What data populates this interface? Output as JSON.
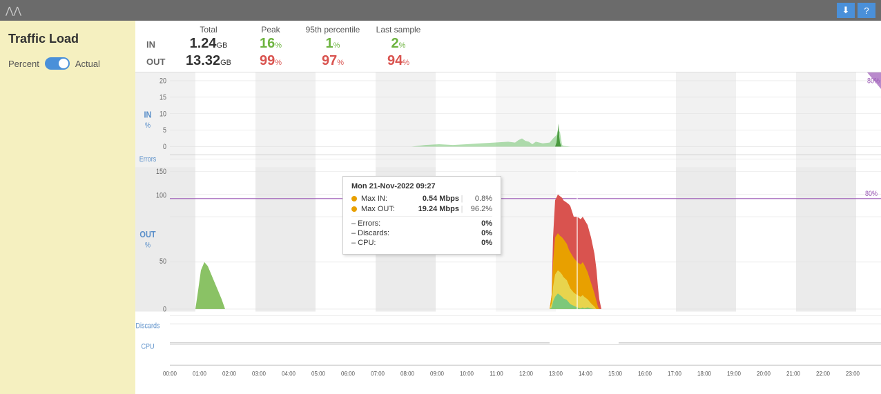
{
  "topbar": {
    "chevron_icon": "chevrons-up",
    "download_icon": "download",
    "help_icon": "question"
  },
  "sidebar": {
    "title": "Traffic Load",
    "percent_label": "Percent",
    "actual_label": "Actual"
  },
  "stats": {
    "headers": [
      "Total",
      "Peak",
      "95th percentile",
      "Last sample"
    ],
    "in_label": "IN",
    "out_label": "OUT",
    "in_total": "1.24",
    "in_total_unit": "GB",
    "in_peak": "16",
    "in_peak_unit": "%",
    "in_95th": "1",
    "in_95th_unit": "%",
    "in_last": "2",
    "in_last_unit": "%",
    "out_total": "13.32",
    "out_total_unit": "GB",
    "out_peak": "99",
    "out_peak_unit": "%",
    "out_95th": "97",
    "out_95th_unit": "%",
    "out_last": "94",
    "out_last_unit": "%"
  },
  "chart": {
    "in_label": "IN\n%",
    "out_label": "OUT\n%",
    "in_y_values": [
      "20",
      "15",
      "10",
      "5",
      "0"
    ],
    "out_y_values": [
      "150",
      "100",
      "50",
      "0"
    ],
    "threshold_label": "80%",
    "threshold_label2": "80%",
    "x_labels": [
      "00:00",
      "01:00",
      "02:00",
      "03:00",
      "04:00",
      "05:00",
      "06:00",
      "07:00",
      "08:00",
      "09:00",
      "10:00",
      "11:00",
      "12:00",
      "13:00",
      "14:00",
      "15:00",
      "16:00",
      "17:00",
      "18:00",
      "19:00",
      "20:00",
      "21:00",
      "22:00",
      "23:00"
    ],
    "section_labels": [
      "Errors",
      "Discards",
      "CPU"
    ],
    "tooltip": {
      "timestamp": "Mon 21-Nov-2022 09:27",
      "max_in_label": "Max IN:",
      "max_in_val": "0.54 Mbps",
      "max_in_pct": "0.8%",
      "max_out_label": "Max OUT:",
      "max_out_val": "19.24 Mbps",
      "max_out_pct": "96.2%",
      "errors_label": "– Errors:",
      "errors_val": "0%",
      "discards_label": "– Discards:",
      "discards_val": "0%",
      "cpu_label": "– CPU:",
      "cpu_val": "0%"
    }
  }
}
